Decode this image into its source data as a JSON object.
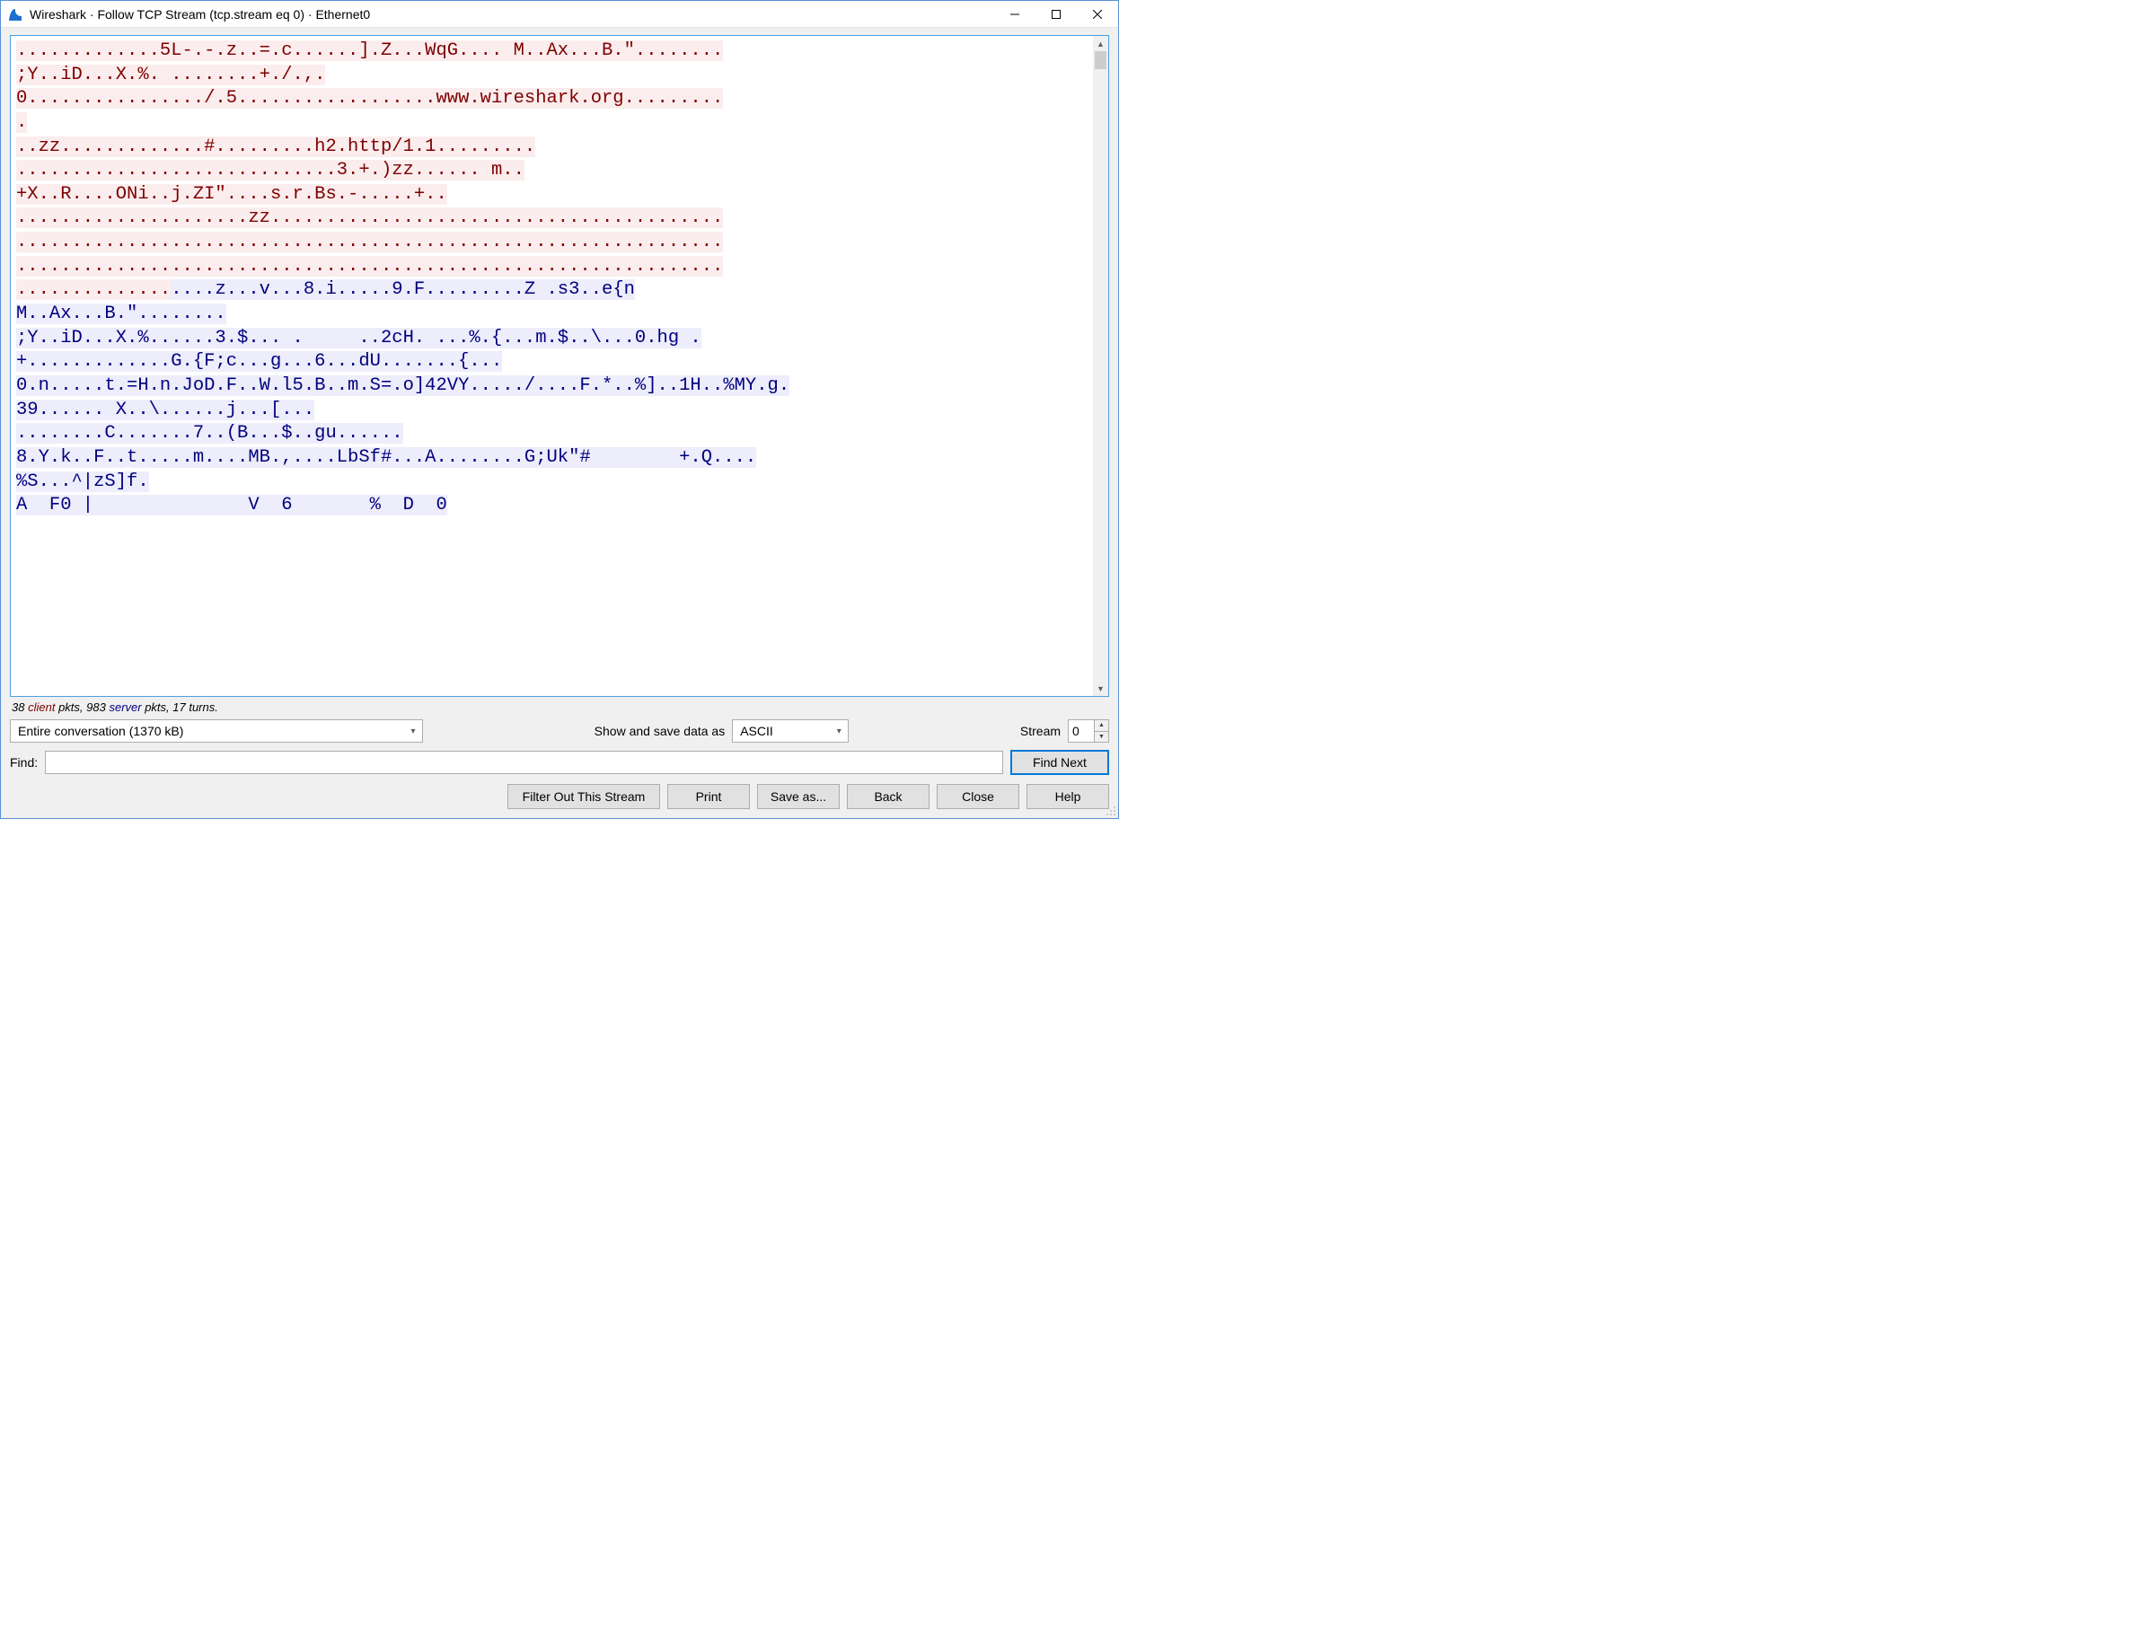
{
  "titlebar": {
    "title": "Wireshark · Follow TCP Stream (tcp.stream eq 0) · Ethernet0"
  },
  "stream": {
    "segments": [
      {
        "side": "client",
        "text": ".............5L-.-.z..=.c......].Z...WqG.... M..Ax...B.\"........\n;Y..iD...X.%. ........+./.,."
      },
      {
        "side": "client",
        "text": "\n0................/.5..................www.wireshark.org.........\n."
      },
      {
        "side": "client",
        "text": "\n..zz.............#.........h2.http/1.1.........\n.............................3.+.)zz...... m..\n+X..R....ONi..j.ZI\"....s.r.Bs.-.....+.."
      },
      {
        "side": "client",
        "text": "\n.....................zz.........................................\n................................................................\n................................................................\n.............."
      },
      {
        "side": "server",
        "text": "....z...v...8.i.....9.F.........Z .s3..e{n\nM..Ax...B.\"........\n;Y..iD...X.%......3.$... .     ..2cH. ...%.{...m.$..\\...0.hg .\n+.............G.{F;c...g...6...dU.......{...\n0.n.....t.=H.n.JoD.F..W.l5.B..m.S=.o]42VY...../....F.*..%]..1H..%MY.g.\n39...... X..\\......j...[...\n........C.......7..(B...$..gu......\n8.Y.k..F..t.....m....MB.,....LbSf#...A........G;Uk\"#        +.Q....\n%S...^|zS]f.\nA  F0 |              V  6       %  D  0"
      }
    ]
  },
  "stats": {
    "client_pkts": "38",
    "client_word": "client",
    "mid1": " pkts, ",
    "server_pkts": "983",
    "server_word": "server",
    "tail": " pkts, 17 turns."
  },
  "controls": {
    "conversation_combo": "Entire conversation (1370 kB)",
    "show_save_label": "Show and save data as",
    "format_combo": "ASCII",
    "stream_label": "Stream",
    "stream_value": "0",
    "find_label": "Find:",
    "find_value": "",
    "find_next": "Find Next"
  },
  "buttons": {
    "filter_out": "Filter Out This Stream",
    "print": "Print",
    "save_as": "Save as...",
    "back": "Back",
    "close": "Close",
    "help": "Help"
  }
}
